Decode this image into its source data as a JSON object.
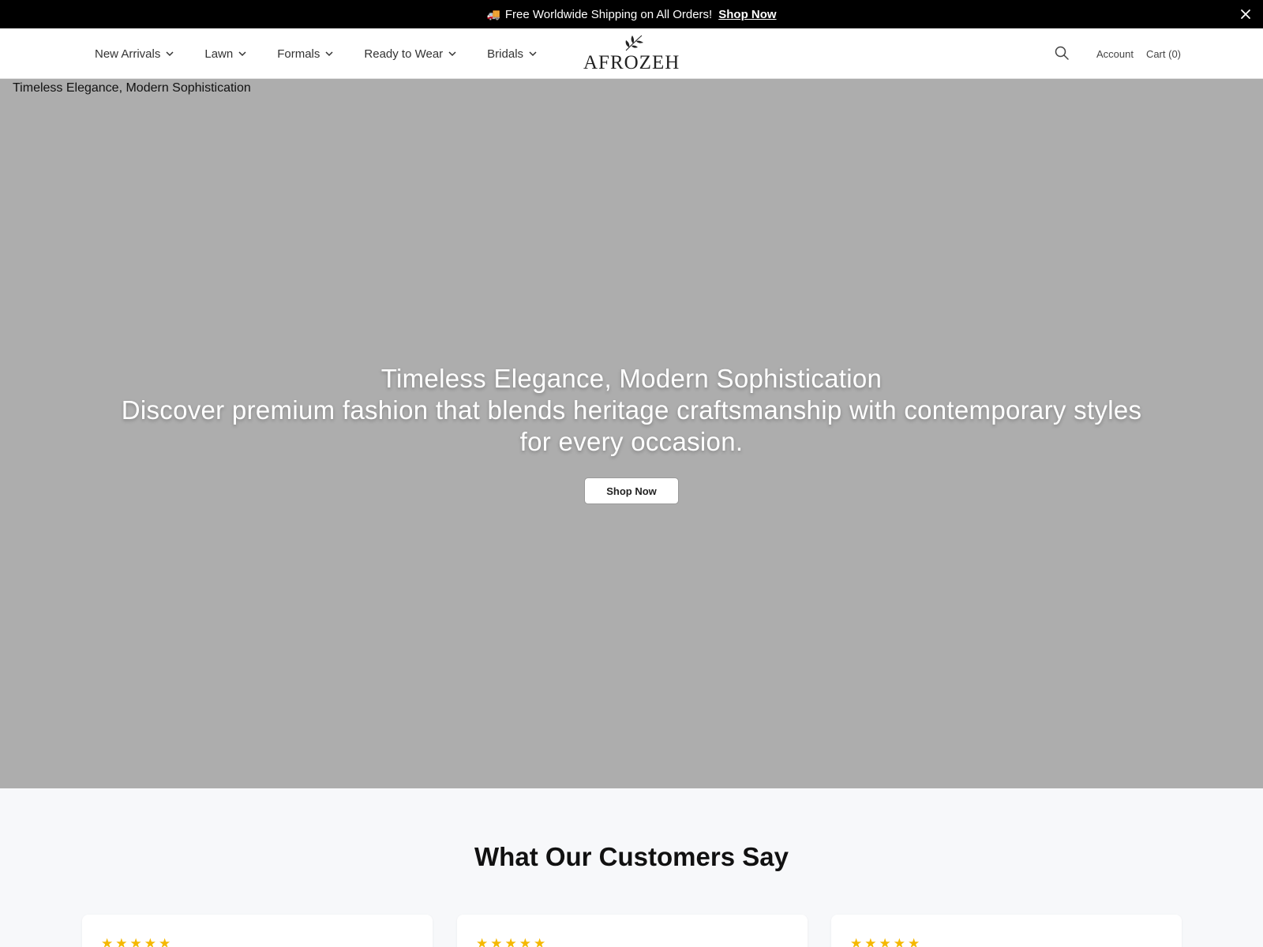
{
  "announcement": {
    "truck_emoji": "🚚",
    "text": "Free Worldwide Shipping on All Orders!",
    "link_label": "Shop Now"
  },
  "header": {
    "nav": [
      {
        "label": "New Arrivals",
        "icon": "chevron-down-icon"
      },
      {
        "label": "Lawn",
        "icon": "chevron-down-icon"
      },
      {
        "label": "Formals",
        "icon": "chevron-down-icon"
      },
      {
        "label": "Ready to Wear",
        "icon": "chevron-down-icon"
      },
      {
        "label": "Bridals",
        "icon": "chevron-down-icon"
      }
    ],
    "logo_text": "AFROZEH",
    "account_label": "Account",
    "cart_label": "Cart (0)"
  },
  "hero": {
    "image_alt": "Timeless Elegance, Modern Sophistication",
    "title": "Timeless Elegance, Modern Sophistication",
    "subtitle": "Discover premium fashion that blends heritage craftsmanship with contemporary styles for every occasion.",
    "button_label": "Shop Now",
    "background_color": "#adadad"
  },
  "testimonials": {
    "heading": "What Our Customers Say",
    "cards": [
      {
        "stars": "★★★★★"
      },
      {
        "stars": "★★★★★"
      },
      {
        "stars": "★★★★★"
      }
    ],
    "star_color": "#f5b800"
  }
}
